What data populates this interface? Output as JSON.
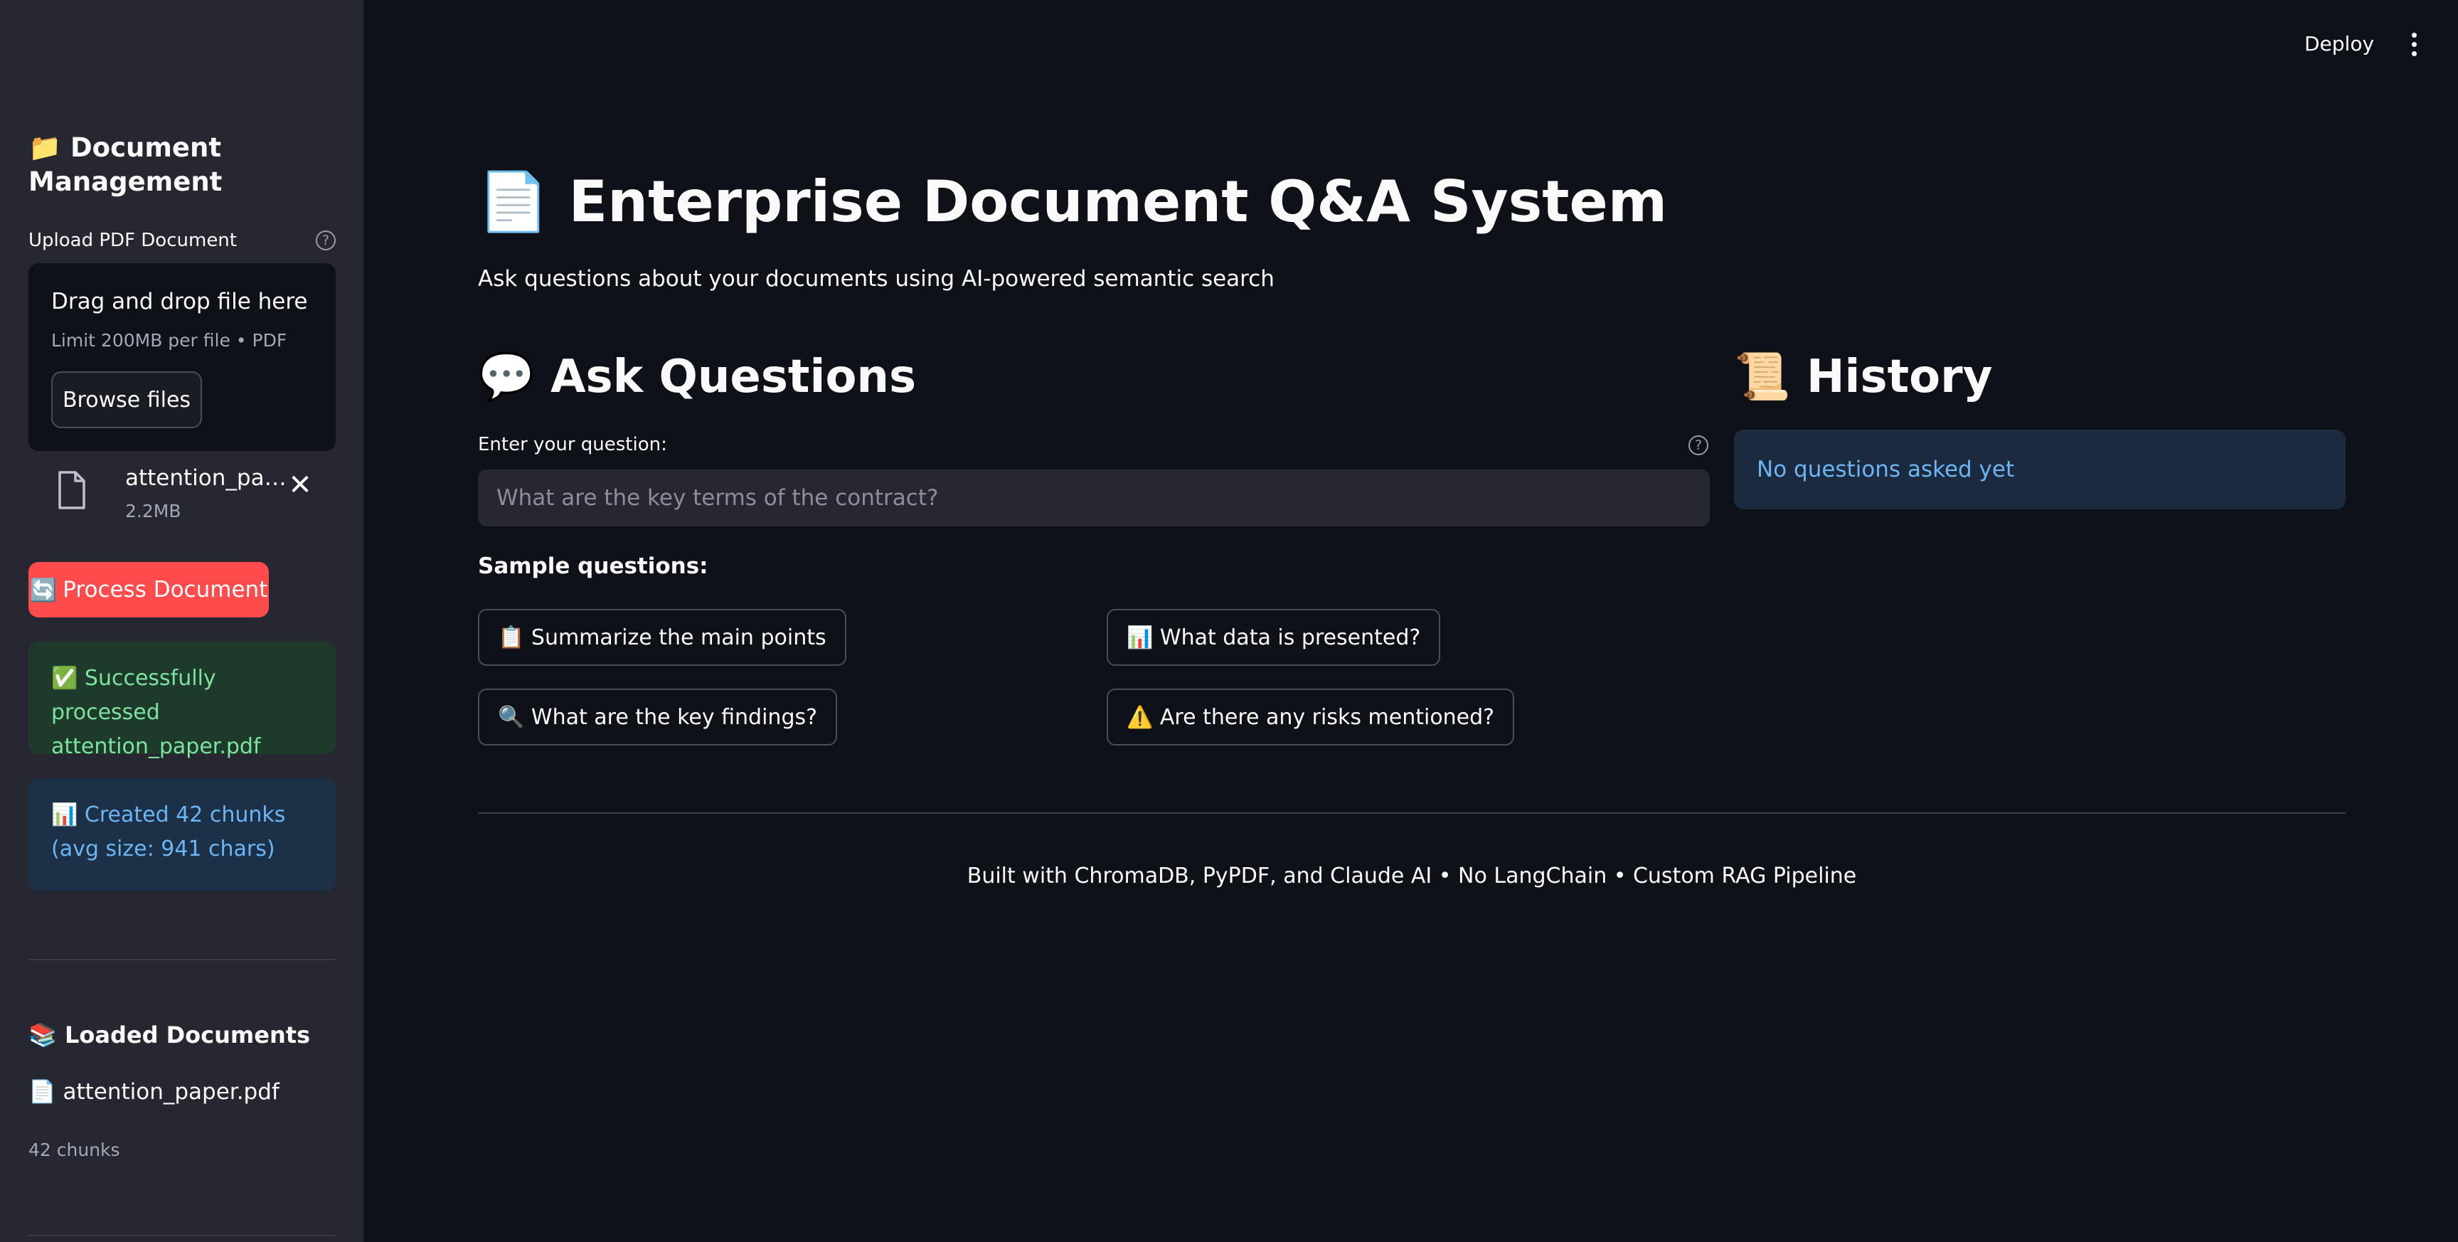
{
  "sidebar": {
    "title_icon": "📁",
    "title": "Document Management",
    "upload_label": "Upload PDF Document",
    "dropzone": {
      "title": "Drag and drop file here",
      "subtitle": "Limit 200MB per file • PDF",
      "browse_label": "Browse files"
    },
    "uploaded_file": {
      "name": "attention_paper.pdf",
      "size": "2.2MB"
    },
    "process_icon": "🔄",
    "process_label": "Process Document",
    "success_icon": "✅",
    "success_message": "Successfully processed attention_paper.pdf",
    "info_icon": "📊",
    "info_message": "Created 42 chunks (avg size: 941 chars)",
    "loaded_icon": "📚",
    "loaded_heading": "Loaded Documents",
    "loaded_doc_icon": "📄",
    "loaded_doc": "attention_paper.pdf",
    "loaded_chunks": "42 chunks"
  },
  "header": {
    "deploy_label": "Deploy"
  },
  "main": {
    "title_icon": "📄",
    "title": "Enterprise Document Q&A System",
    "subtitle": "Ask questions about your documents using AI-powered semantic search",
    "ask_icon": "💬",
    "ask_heading": "Ask Questions",
    "question_label": "Enter your question:",
    "question_placeholder": "What are the key terms of the contract?",
    "question_value": "",
    "sample_label": "Sample questions:",
    "sample_questions": [
      {
        "icon": "📋",
        "label": "Summarize the main points"
      },
      {
        "icon": "📊",
        "label": "What data is presented?"
      },
      {
        "icon": "🔍",
        "label": "What are the key findings?"
      },
      {
        "icon": "⚠️",
        "label": "Are there any risks mentioned?"
      }
    ],
    "history_icon": "📜",
    "history_heading": "History",
    "history_empty": "No questions asked yet",
    "footer": "Built with ChromaDB, PyPDF, and Claude AI • No LangChain • Custom RAG Pipeline"
  },
  "colors": {
    "background": "#0e1117",
    "sidebar": "#262730",
    "primary_button": "#ff4b4b",
    "success_bg": "#1d3a2a",
    "success_text": "#7ee2a0",
    "info_bg": "#1c3048",
    "info_text": "#6cb5f5"
  }
}
